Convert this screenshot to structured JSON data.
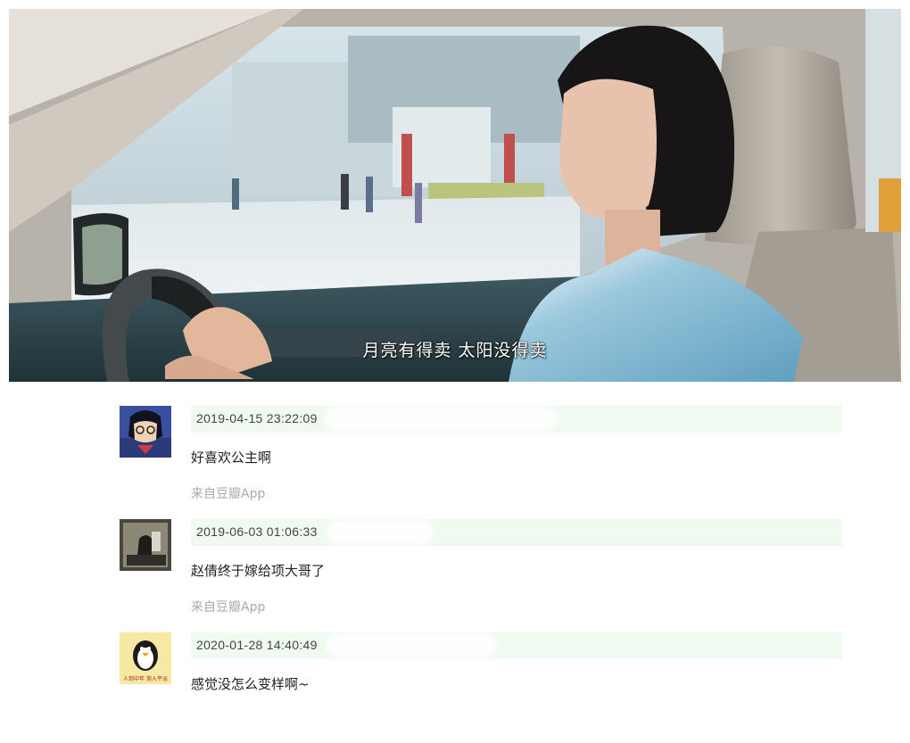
{
  "video": {
    "subtitle": "月亮有得卖 太阳没得卖"
  },
  "comments": [
    {
      "avatar": "anime-boy-avatar",
      "timestamp": "2019-04-15 23:22:09",
      "text": "好喜欢公主啊",
      "source": "来自豆瓣App"
    },
    {
      "avatar": "old-photo-avatar",
      "timestamp": "2019-06-03 01:06:33",
      "text": "赵倩终于嫁给项大哥了",
      "source": "来自豆瓣App"
    },
    {
      "avatar": "penguin-avatar",
      "timestamp": "2020-01-28 14:40:49",
      "text": "感觉没怎么变样啊~",
      "avatar_caption": "人到中年 渐入平淡"
    }
  ]
}
